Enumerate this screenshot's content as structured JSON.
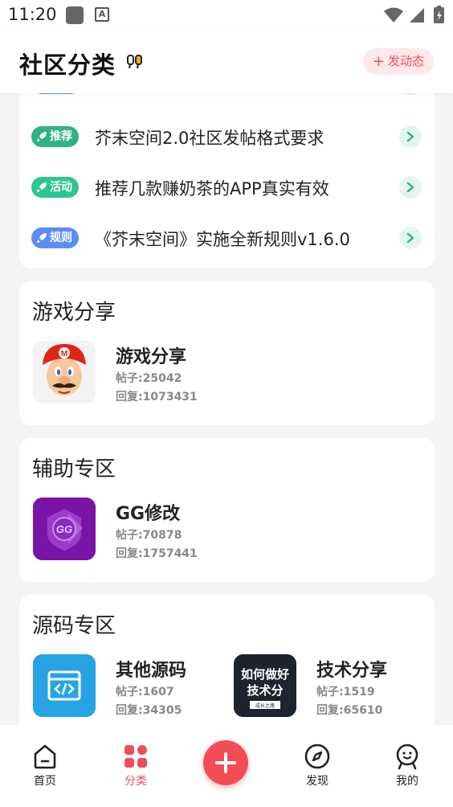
{
  "status_bar": {
    "time": "11:20"
  },
  "header": {
    "title": "社区分类",
    "post_button": "发动态"
  },
  "notices": [
    {
      "tag": "推荐",
      "tag_color": "#2eb383",
      "text": "芥末空间2.0社区发帖格式要求"
    },
    {
      "tag": "活动",
      "tag_color": "#2fc58f",
      "text": "推荐几款赚奶茶的APP真实有效"
    },
    {
      "tag": "规则",
      "tag_color": "#5b8ef5",
      "text": "《芥末空间》实施全新规则v1.6.0"
    }
  ],
  "sections": [
    {
      "title": "游戏分享",
      "forums": [
        {
          "name": "游戏分享",
          "posts": "帖子:25042",
          "replies": "回复:1073431",
          "icon": "mario-icon"
        }
      ]
    },
    {
      "title": "辅助专区",
      "forums": [
        {
          "name": "GG修改",
          "posts": "帖子:70878",
          "replies": "回复:1757441",
          "icon": "game-guardian-icon"
        }
      ]
    },
    {
      "title": "源码专区",
      "forums": [
        {
          "name": "其他源码",
          "posts": "帖子:1607",
          "replies": "回复:34305",
          "icon": "code-window-icon"
        },
        {
          "name": "技术分享",
          "posts": "帖子:1519",
          "replies": "回复:65610",
          "icon": "tech-share-thumbnail",
          "thumb_lines": [
            "如何做好",
            "技术分",
            "成长之路"
          ]
        }
      ]
    }
  ],
  "bottom_nav": [
    {
      "label": "首页",
      "icon": "home-icon"
    },
    {
      "label": "分类",
      "icon": "category-icon",
      "active": true
    },
    {
      "label": "发现",
      "icon": "compass-icon"
    },
    {
      "label": "我的",
      "icon": "profile-icon"
    }
  ],
  "colors": {
    "accent": "#f04c5c",
    "green": "#2eb383"
  }
}
